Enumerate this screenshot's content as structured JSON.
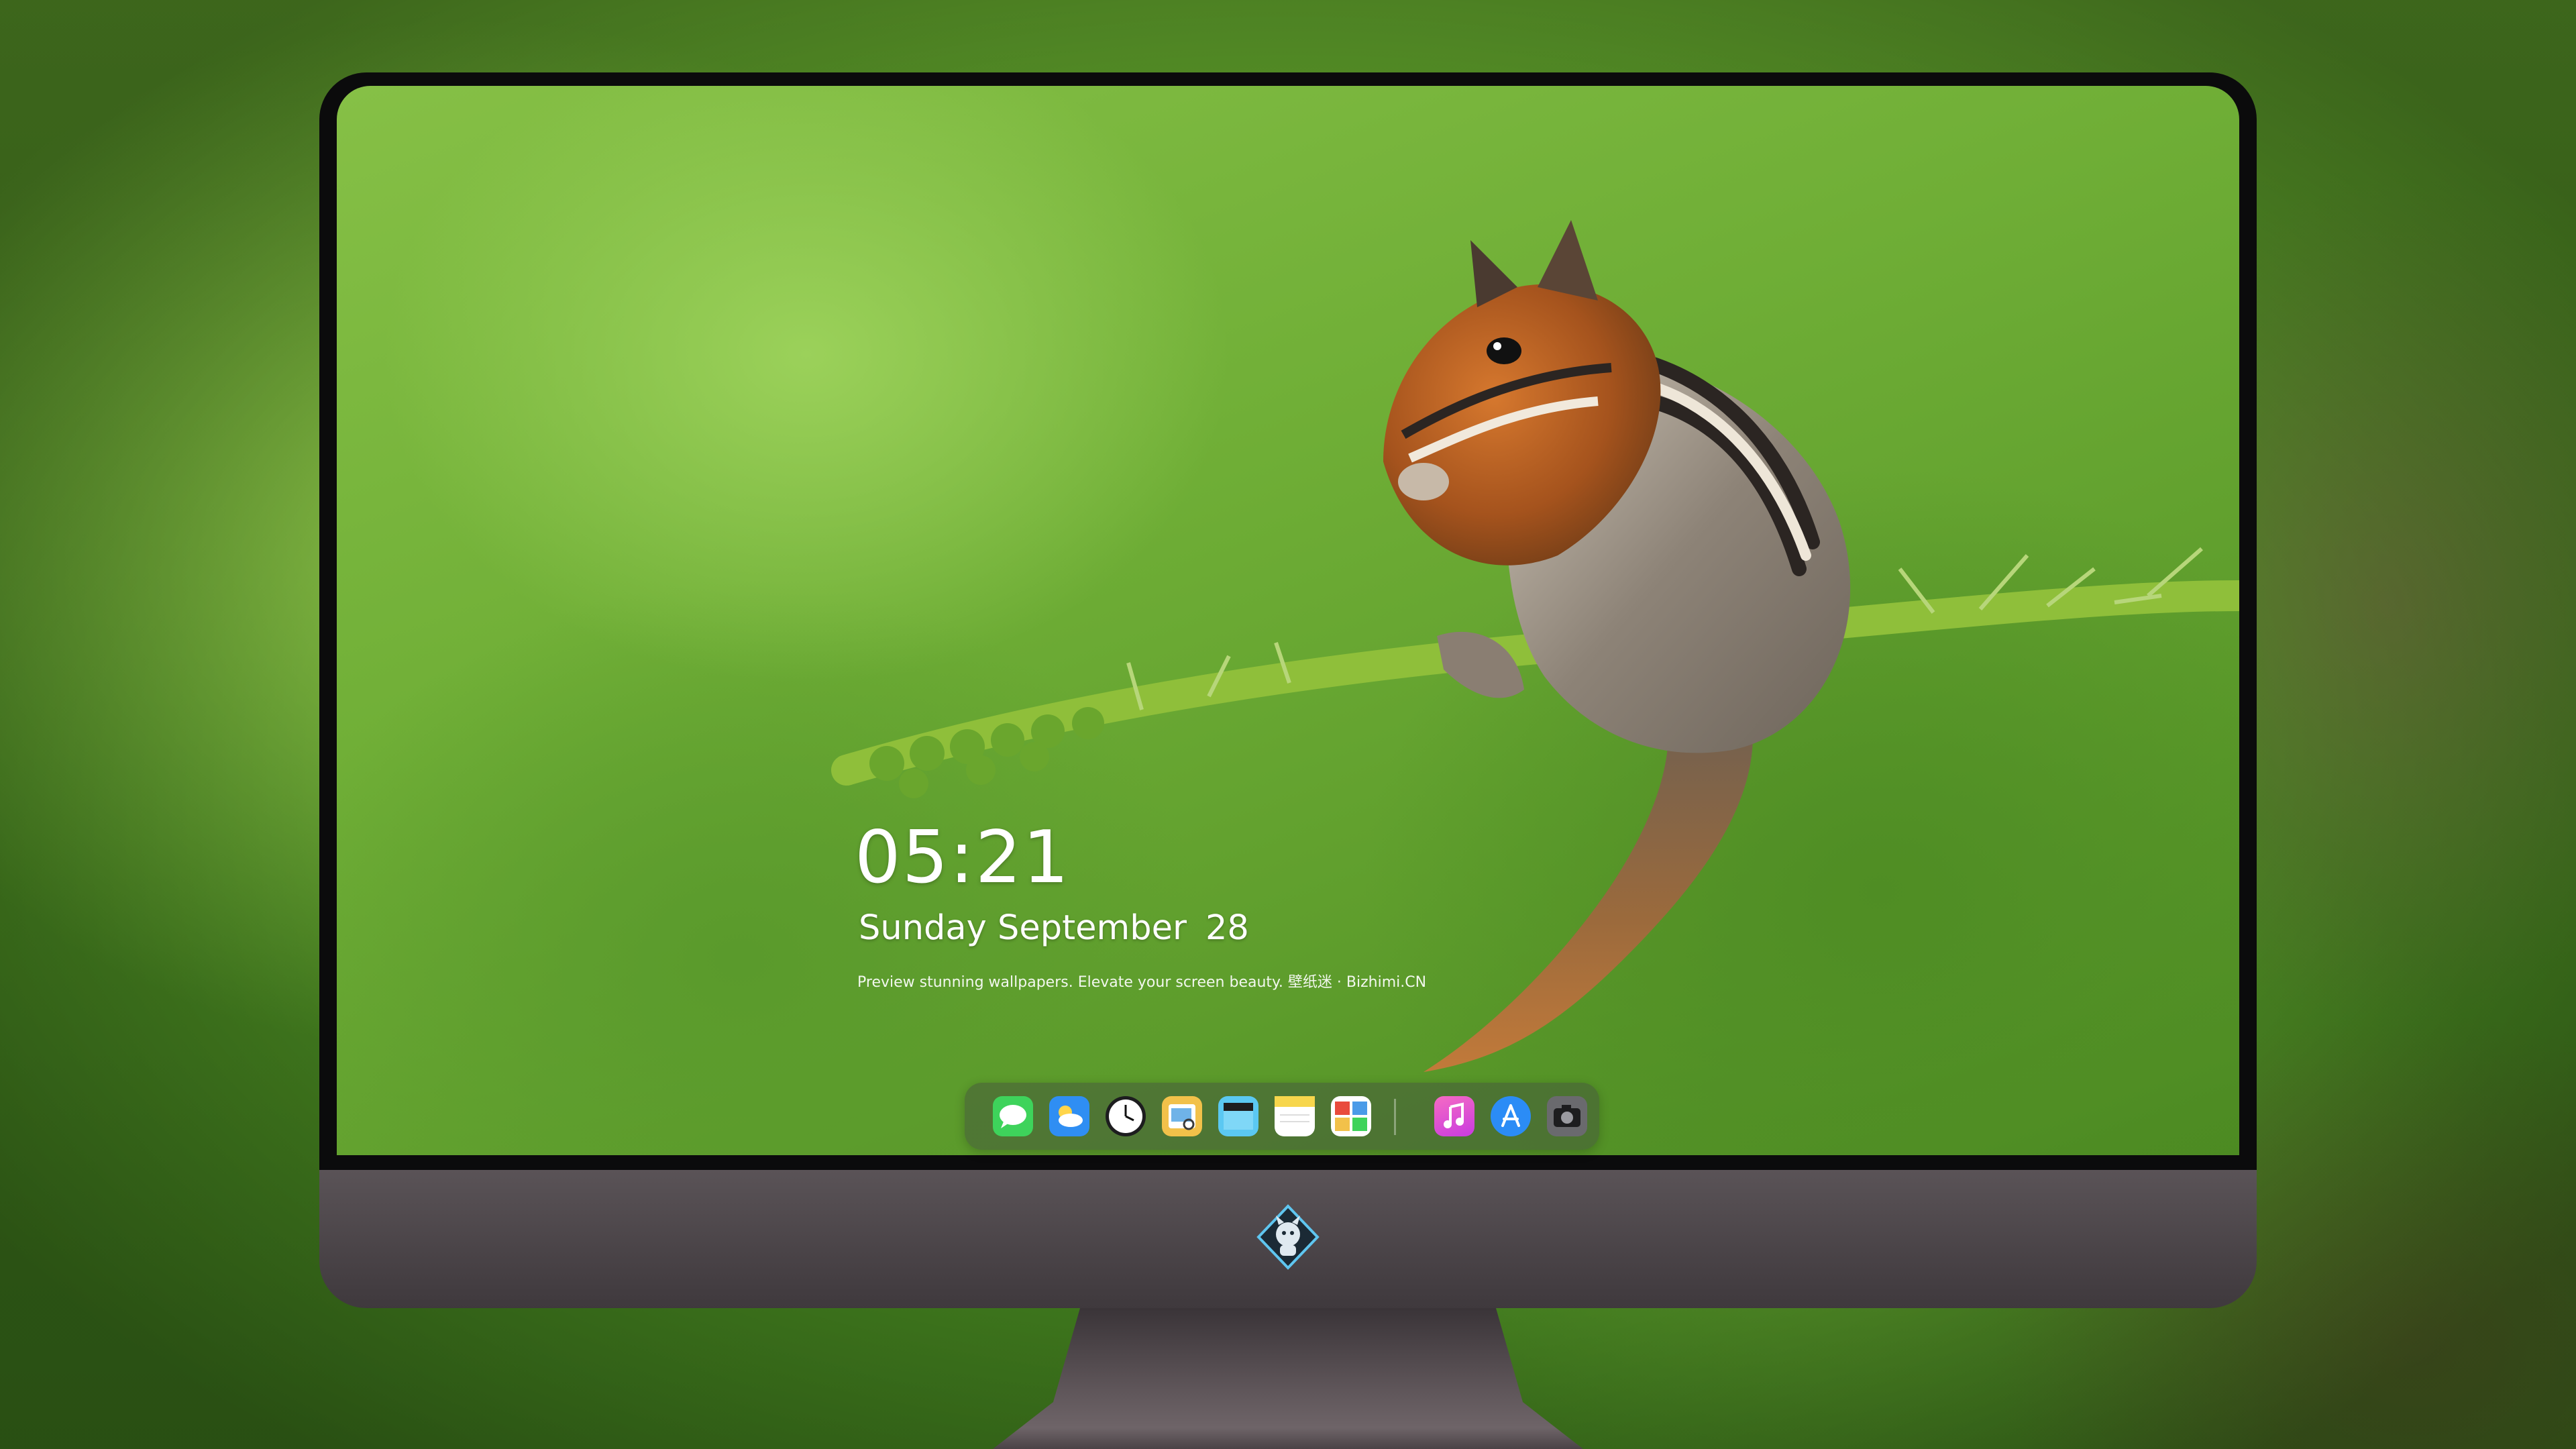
{
  "lockscreen": {
    "time": "05:21",
    "date_weekday_month": "Sunday September",
    "date_day": "28",
    "tagline": "Preview stunning wallpapers. Elevate your screen beauty. 壁纸迷 · Bizhimi.CN"
  },
  "dock": {
    "items": [
      {
        "name": "messages",
        "icon": "messages-icon",
        "color": "#3ed35b"
      },
      {
        "name": "weather",
        "icon": "weather-icon",
        "color": "#2f8ef3"
      },
      {
        "name": "clock",
        "icon": "clock-icon",
        "color": "#1d1d1f"
      },
      {
        "name": "preview",
        "icon": "preview-icon",
        "color": "#f2c14a"
      },
      {
        "name": "clips",
        "icon": "clips-icon",
        "color": "#5bc8f2"
      },
      {
        "name": "notes",
        "icon": "notes-icon",
        "color": "#f7d64c"
      },
      {
        "name": "photo-booth",
        "icon": "photo-booth-icon",
        "color": "#e94b3c"
      },
      {
        "name": "music",
        "icon": "music-icon",
        "color": "#e83ea0"
      },
      {
        "name": "app-store",
        "icon": "app-store-icon",
        "color": "#2b8cf6"
      },
      {
        "name": "camera",
        "icon": "camera-icon",
        "color": "#6a6a6e"
      }
    ]
  },
  "colors": {
    "bezel": "#0b0b0c",
    "chin": "#4a4347",
    "wallpaper_green": "#6fae36"
  }
}
